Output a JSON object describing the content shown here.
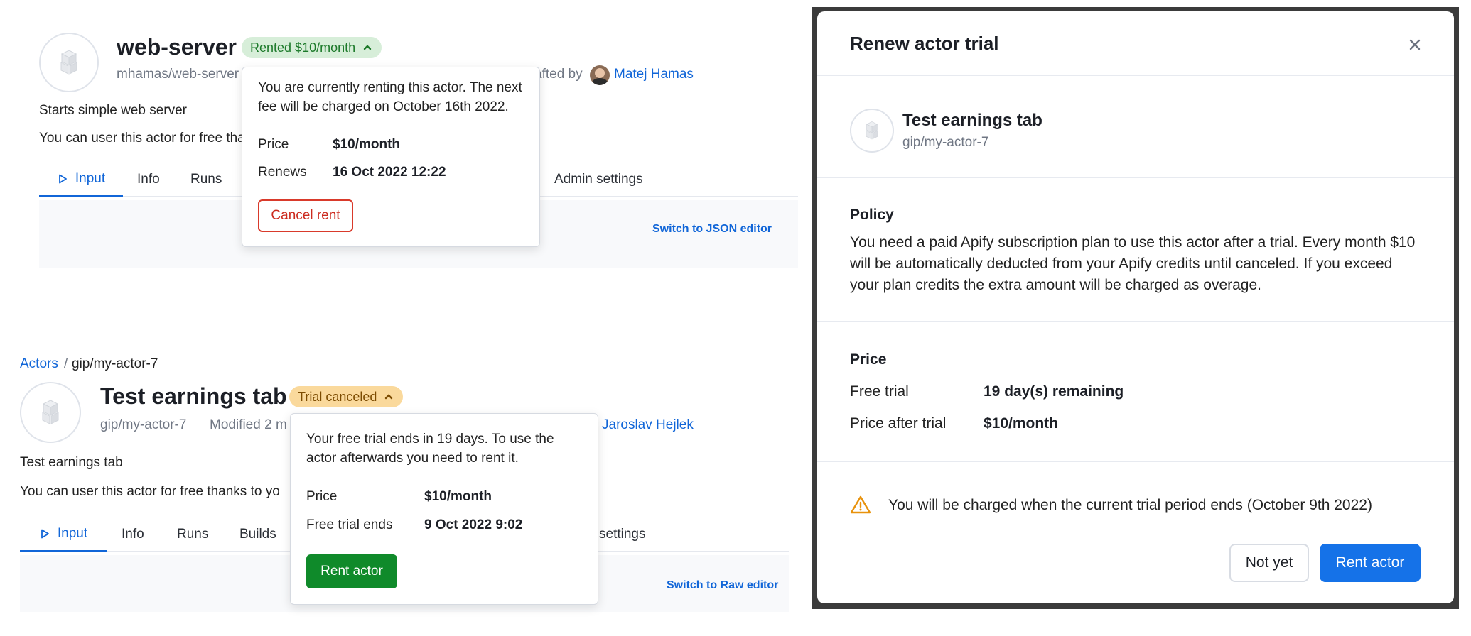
{
  "actor1": {
    "title": "web-server",
    "badge": "Rented $10/month",
    "slug": "mhamas/web-server",
    "crafted_by_fragment": "afted by",
    "author": "Matej Hamas",
    "description": "Starts simple web server",
    "info_text_fragment": "You can user this actor for free tha",
    "tabs": [
      "Input",
      "Info",
      "Runs",
      "Admin settings"
    ],
    "switch_link": "Switch to JSON editor",
    "popover": {
      "text": "You are currently renting this actor. The next fee will be charged on October 16th 2022.",
      "rows": [
        {
          "key": "Price",
          "value": "$10/month"
        },
        {
          "key": "Renews",
          "value": "16 Oct 2022 12:22"
        }
      ],
      "button": "Cancel rent"
    }
  },
  "actor2": {
    "breadcrumb_root": "Actors",
    "breadcrumb_sep": "/",
    "breadcrumb_current": "gip/my-actor-7",
    "title": "Test earnings tab",
    "badge": "Trial canceled",
    "slug": "gip/my-actor-7",
    "modified_fragment": "Modified 2 m",
    "author": "Jaroslav Hejlek",
    "description": "Test earnings tab",
    "info_text_fragment": "You can user this actor for free thanks to yo",
    "tabs": [
      "Input",
      "Info",
      "Runs",
      "Builds",
      "settings"
    ],
    "switch_link": "Switch to Raw editor",
    "popover": {
      "text": "Your free trial ends in 19 days. To use the actor afterwards you need to rent it.",
      "rows": [
        {
          "key": "Price",
          "value": "$10/month"
        },
        {
          "key": "Free trial ends",
          "value": "9 Oct 2022 9:02"
        }
      ],
      "button": "Rent actor"
    }
  },
  "modal": {
    "title": "Renew actor trial",
    "actor_name": "Test earnings tab",
    "actor_slug": "gip/my-actor-7",
    "policy_heading": "Policy",
    "policy_text": "You need a paid Apify subscription plan to use this actor after a trial. Every month $10 will be automatically deducted from your Apify credits until canceled. If you exceed your plan credits the extra amount will be charged as overage.",
    "price_heading": "Price",
    "price_rows": [
      {
        "key": "Free trial",
        "value": "19 day(s) remaining"
      },
      {
        "key": "Price after trial",
        "value": "$10/month"
      }
    ],
    "warning": "You will be charged when the current trial period ends (October 9th 2022)",
    "btn_secondary": "Not yet",
    "btn_primary": "Rent actor"
  },
  "colors": {
    "accent_blue": "#1166d8",
    "primary_button": "#1572e8",
    "success_green": "#0f8a2a",
    "danger_red": "#cc2b1f",
    "rented_badge_bg": "#d7eed9",
    "trial_badge_bg": "#fad99c",
    "warning_orange": "#e8920c"
  }
}
